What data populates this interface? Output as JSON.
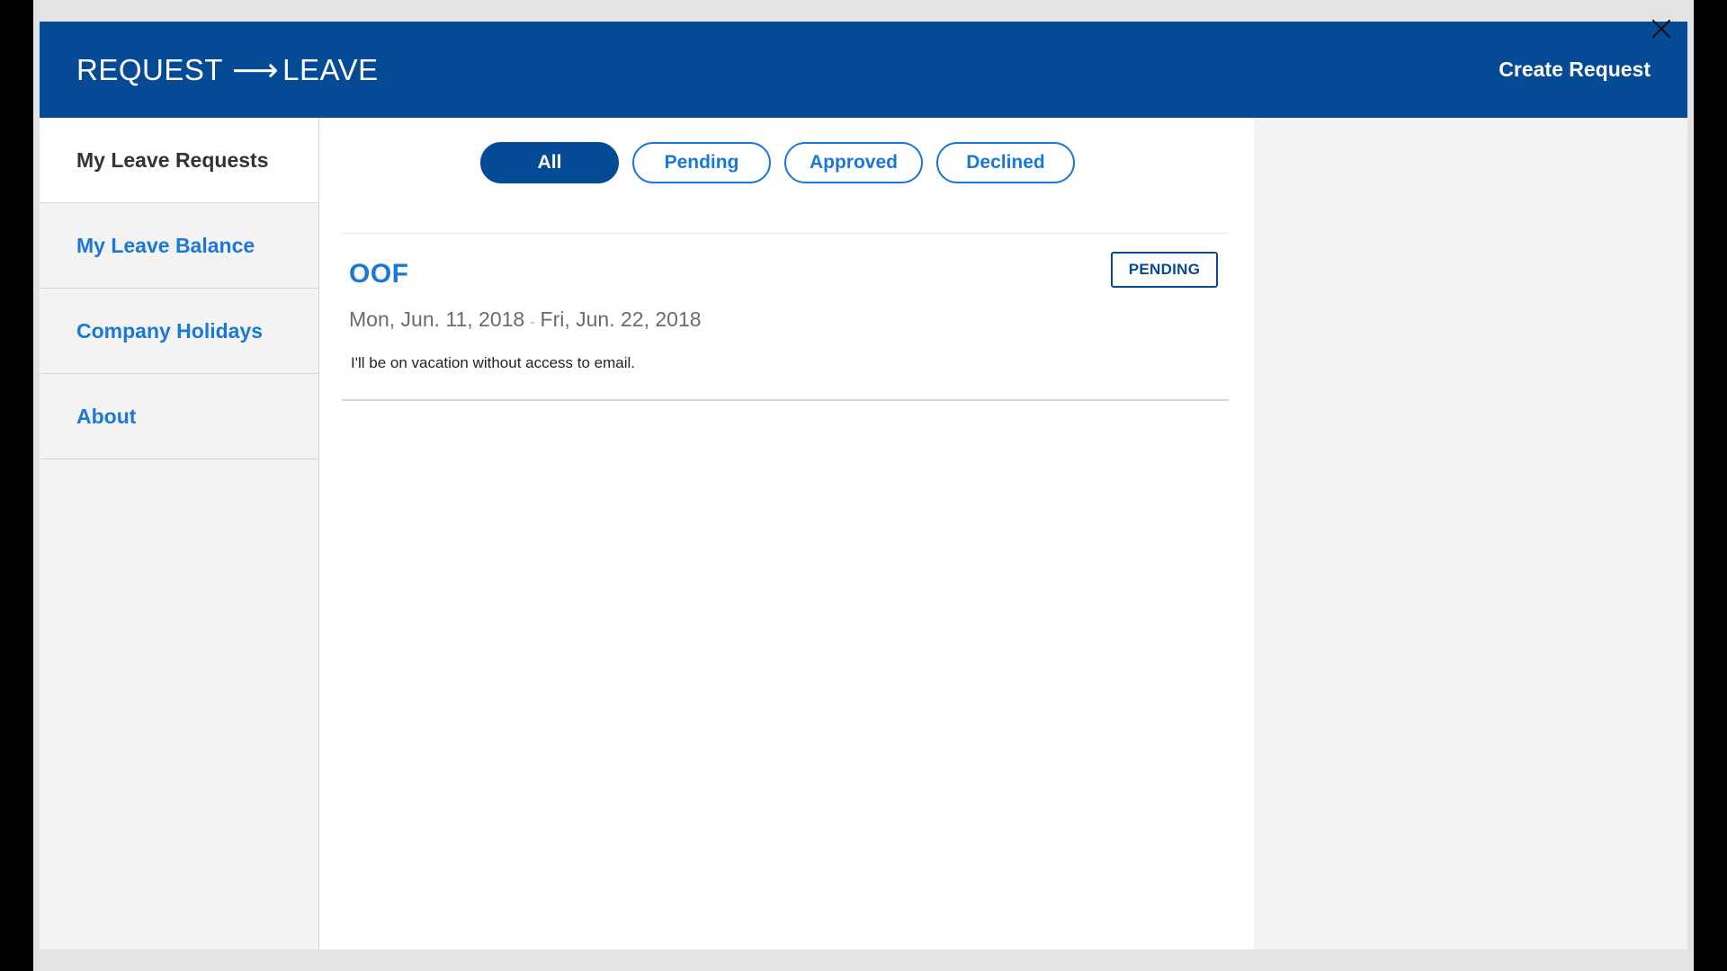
{
  "header": {
    "brand_left": "REQUEST",
    "brand_arrow": "⟶",
    "brand_right": "LEAVE",
    "create_label": "Create Request"
  },
  "colors": {
    "header_bg": "#044a95",
    "accent": "#1a78d8",
    "sidebar_bg": "#f3f3f3"
  },
  "sidebar": {
    "items": [
      {
        "label": "My Leave Requests",
        "active": true
      },
      {
        "label": "My Leave Balance",
        "active": false
      },
      {
        "label": "Company Holidays",
        "active": false
      },
      {
        "label": "About",
        "active": false
      }
    ]
  },
  "filters": [
    {
      "label": "All",
      "active": true
    },
    {
      "label": "Pending",
      "active": false
    },
    {
      "label": "Approved",
      "active": false
    },
    {
      "label": "Declined",
      "active": false
    }
  ],
  "requests": [
    {
      "title": "OOF",
      "start_date": "Mon, Jun. 11, 2018",
      "date_separator": "-",
      "end_date": "Fri, Jun. 22, 2018",
      "description": "I'll be on vacation without access to email.",
      "status": "PENDING"
    }
  ],
  "icons": {
    "close": "close-icon"
  }
}
